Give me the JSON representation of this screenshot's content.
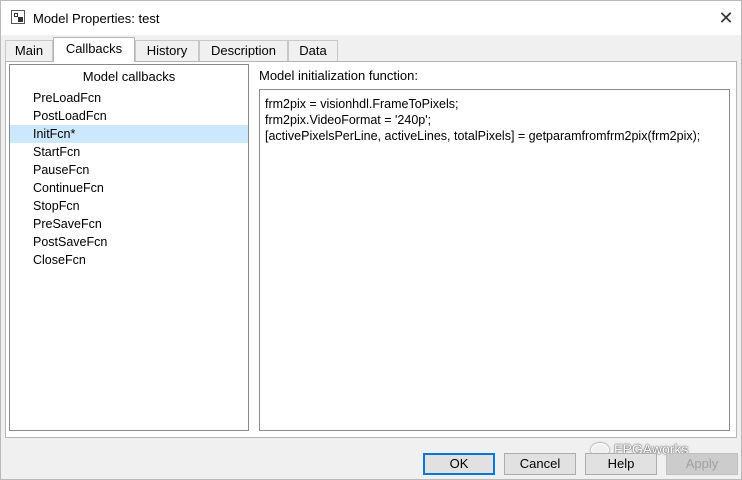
{
  "window": {
    "title": "Model Properties: test"
  },
  "tabs": [
    {
      "label": "Main"
    },
    {
      "label": "Callbacks"
    },
    {
      "label": "History"
    },
    {
      "label": "Description"
    },
    {
      "label": "Data"
    }
  ],
  "active_tab": "Callbacks",
  "callbacks": {
    "header": "Model callbacks",
    "items": [
      {
        "label": "PreLoadFcn"
      },
      {
        "label": "PostLoadFcn"
      },
      {
        "label": "InitFcn*"
      },
      {
        "label": "StartFcn"
      },
      {
        "label": "PauseFcn"
      },
      {
        "label": "ContinueFcn"
      },
      {
        "label": "StopFcn"
      },
      {
        "label": "PreSaveFcn"
      },
      {
        "label": "PostSaveFcn"
      },
      {
        "label": "CloseFcn"
      }
    ],
    "selected": "InitFcn*"
  },
  "editor": {
    "label": "Model initialization function:",
    "code": "frm2pix = visionhdl.FrameToPixels;\nfrm2pix.VideoFormat = '240p';\n[activePixelsPerLine, activeLines, totalPixels] = getparamfromfrm2pix(frm2pix);"
  },
  "buttons": {
    "ok": "OK",
    "cancel": "Cancel",
    "help": "Help",
    "apply": "Apply"
  },
  "watermark": "FPGAworks",
  "colors": {
    "selection": "#cce8ff",
    "default_button_border": "#0078d7"
  }
}
